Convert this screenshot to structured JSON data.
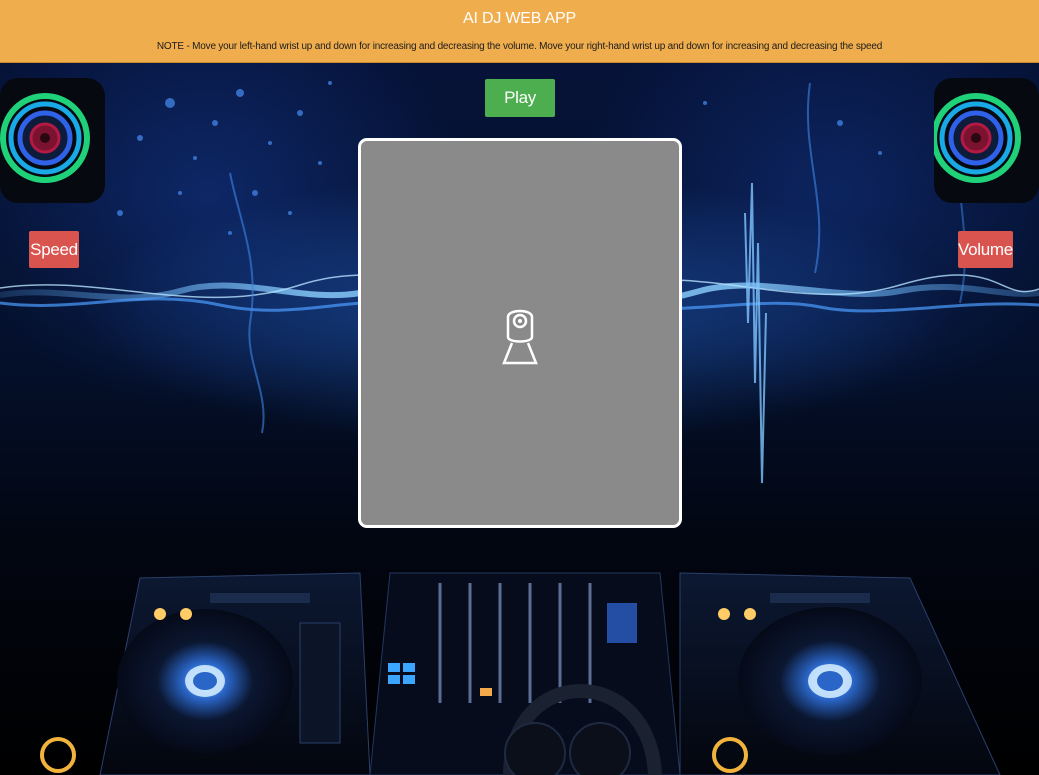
{
  "header": {
    "title": "AI DJ WEB APP",
    "note": "NOTE - Move your left-hand wrist up and down for increasing and decreasing the volume. Move your right-hand wrist up and down for increasing and decreasing the speed"
  },
  "controls": {
    "play_label": "Play",
    "speed_label": "Speed",
    "volume_label": "Volume"
  },
  "icons": {
    "webcam": "webcam-icon",
    "speaker_left": "speaker-icon",
    "speaker_right": "speaker-icon"
  },
  "colors": {
    "header_bg": "#efad4e",
    "play_button": "#4cae4f",
    "side_buttons": "#d9534f",
    "webcam_bg": "#8a8a8a"
  }
}
